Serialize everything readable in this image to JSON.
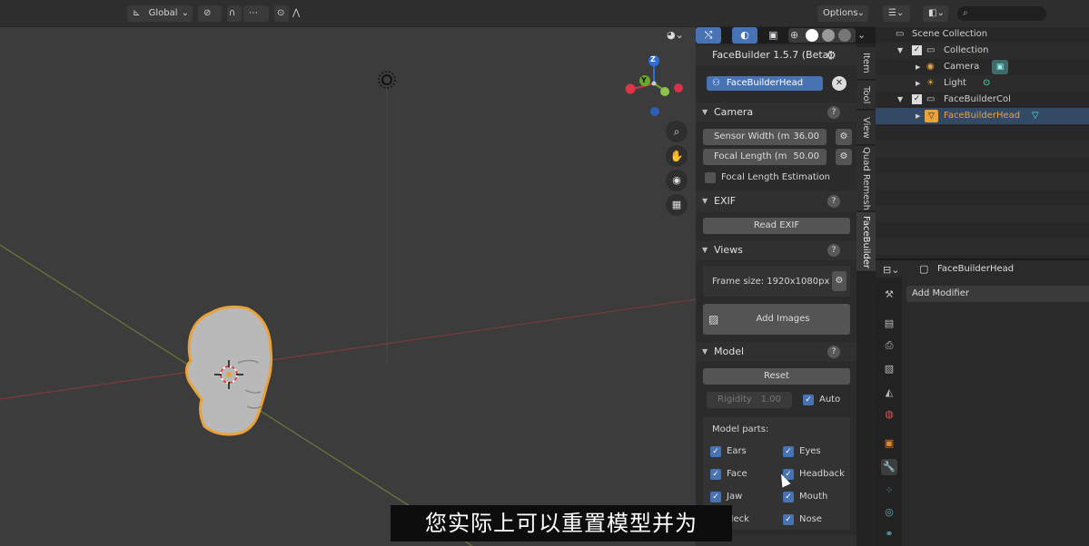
{
  "header": {
    "orientation": "Global",
    "options": "Options",
    "search_placeholder": ""
  },
  "gizmo": {
    "z": "Z",
    "y": "Y"
  },
  "panel": {
    "title": "FaceBuilder 1.5.7 (Beta)",
    "head_name": "FaceBuilderHead",
    "camera": {
      "label": "Camera",
      "sensor_label": "Sensor Width (m",
      "sensor_value": "36.00",
      "focal_label": "Focal Length (m",
      "focal_value": "50.00",
      "estimation_label": "Focal Length Estimation"
    },
    "exif": {
      "label": "EXIF",
      "read_btn": "Read EXIF"
    },
    "views": {
      "label": "Views",
      "frame_size": "Frame size: 1920x1080px",
      "add_images": "Add Images"
    },
    "model": {
      "label": "Model",
      "reset": "Reset",
      "rigidity_label": "Rigidity",
      "rigidity_value": "1.00",
      "auto": "Auto",
      "parts_label": "Model parts:",
      "parts": {
        "ears": "Ears",
        "eyes": "Eyes",
        "face": "Face",
        "headback": "Headback",
        "jaw": "Jaw",
        "mouth": "Mouth",
        "neck": "Neck",
        "nose": "Nose"
      }
    }
  },
  "tabs": {
    "item": "Item",
    "tool": "Tool",
    "view": "View",
    "quad": "Quad Remesh",
    "facebuilder": "FaceBuilder"
  },
  "outliner": {
    "scene_collection": "Scene Collection",
    "collection": "Collection",
    "camera": "Camera",
    "light": "Light",
    "fb_col": "FaceBuilderCol",
    "fb_head": "FaceBuilderHead"
  },
  "properties": {
    "object_name": "FaceBuilderHead",
    "add_modifier": "Add Modifier"
  },
  "subtitle": "您实际上可以重置模型并为",
  "colors": {
    "accent": "#4772b3",
    "selected": "#e8a33c",
    "x_axis": "#a8353f"
  }
}
